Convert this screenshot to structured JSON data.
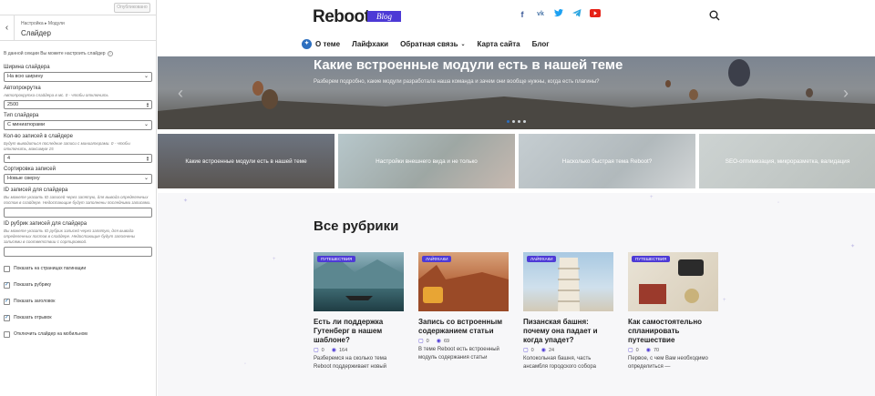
{
  "customizer": {
    "publish_label": "Опубликовано",
    "breadcrumb": "Настройка ▸ Модули",
    "title": "Слайдер",
    "intro": "В данной секции Вы можете настроить слайдер",
    "width_label": "Ширина слайдера",
    "width_value": "На всю ширину",
    "autoplay_label": "Автопрокрутка",
    "autoplay_note": "Автопрокрутка слайдера в мс. 0 - чтобы отключить",
    "autoplay_value": "2500",
    "type_label": "Тип слайдера",
    "type_value": "С миниатюрами",
    "count_label": "Кол-во записей в слайдере",
    "count_note": "Будут выводиться последние записи с миниатюрами. 0 - чтобы отключить, максимум 15",
    "count_value": "4",
    "sort_label": "Сортировка записей",
    "sort_value": "Новые сверху",
    "ids_label": "ID записей для слайдера",
    "ids_note": "Вы можете указать ID записей через запятую, для вывода определенных постов в слайдере. Недостающие будут заполнены последними записями.",
    "cat_ids_label": "ID рубрик записей для слайдера",
    "cat_ids_note": "Вы можете указать ID рубрик записей через запятую, для вывода определенных постов в слайдере. Недостающие будут заполнены записями в соответствии с сортировкой.",
    "checkboxes": [
      {
        "label": "Показать на страницах пагинации",
        "checked": false
      },
      {
        "label": "Показать рубрику",
        "checked": true
      },
      {
        "label": "Показать заголовок",
        "checked": true
      },
      {
        "label": "Показать отрывок",
        "checked": true
      },
      {
        "label": "Отключить слайдер на мобильном",
        "checked": false
      }
    ]
  },
  "site": {
    "logo": "Reboot",
    "logo_badge": "Blog",
    "social_icons": [
      "facebook-icon",
      "vk-icon",
      "twitter-icon",
      "telegram-icon",
      "youtube-icon"
    ],
    "nav": [
      "О теме",
      "Лайфхаки",
      "Обратная связь",
      "Карта сайта",
      "Блог"
    ],
    "hero": {
      "title": "Какие встроенные модули есть в нашей теме",
      "subtitle": "Разберем подробно, какие модули разработала наша команда и зачем они вообще нужны, когда есть плагины?"
    },
    "tiles": [
      "Какие встроенные модули есть в нашей теме",
      "Настройки внешнего вида и не только",
      "Насколько быстрая тема Reboot?",
      "SEO-оптимизация, микроразметка, валидация"
    ],
    "section_title": "Все рубрики",
    "cards": [
      {
        "badge": "ПУТЕШЕСТВИЯ",
        "title": "Есть ли поддержка Гутенберг в нашем шаблоне?",
        "comments": "0",
        "views": "164",
        "excerpt": "Разберемся на сколько тема Reboot поддерживает новый"
      },
      {
        "badge": "ЛАЙФХАКИ",
        "title": "Запись со встроенным содержанием статьи",
        "comments": "0",
        "views": "69",
        "excerpt": "В теме Reboot есть встроенный модуль содержания статьи"
      },
      {
        "badge": "ЛАЙФХАКИ",
        "title": "Пизанская башня: почему она падает и когда упадет?",
        "comments": "0",
        "views": "24",
        "excerpt": "Колокольная башня, часть ансамбля городского собора"
      },
      {
        "badge": "ПУТЕШЕСТВИЯ",
        "title": "Как самостоятельно спланировать путешествие",
        "comments": "0",
        "views": "70",
        "excerpt": "Первое, с чем Вам необходимо определиться —"
      }
    ]
  },
  "colors": {
    "accent": "#4d3ad6",
    "link": "#2d6fbf"
  }
}
